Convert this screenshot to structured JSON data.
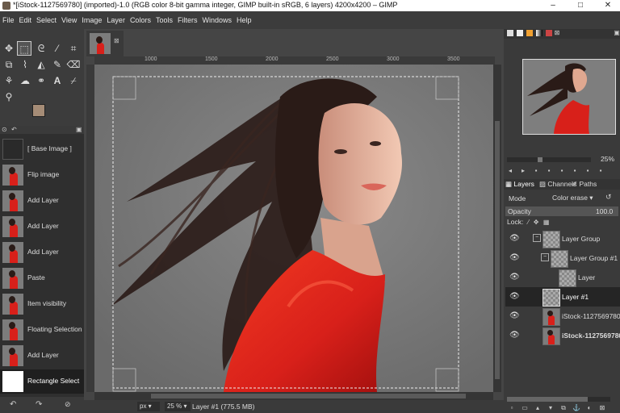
{
  "window": {
    "title": "*[iStock-1127569780] (imported)-1.0 (RGB color 8-bit gamma integer, GIMP built-in sRGB, 6 layers) 4200x4200 – GIMP",
    "controls": [
      "–",
      "□",
      "✕"
    ]
  },
  "menu": [
    "File",
    "Edit",
    "Select",
    "View",
    "Image",
    "Layer",
    "Colors",
    "Tools",
    "Filters",
    "Windows",
    "Help"
  ],
  "undo_history": [
    {
      "label": "[ Base Image ]"
    },
    {
      "label": "Flip image"
    },
    {
      "label": "Add Layer"
    },
    {
      "label": "Add Layer"
    },
    {
      "label": "Add Layer"
    },
    {
      "label": "Paste"
    },
    {
      "label": "Item visibility"
    },
    {
      "label": "Floating Selection t"
    },
    {
      "label": "Add Layer"
    },
    {
      "label": "Rectangle Select"
    }
  ],
  "ruler": {
    "labels": [
      "1000",
      "1500",
      "2000",
      "2500",
      "3000",
      "3500"
    ]
  },
  "status": {
    "unit": "px",
    "zoom": "25 %",
    "layer_info": "Layer #1 (775.5 MB)"
  },
  "navigation": {
    "zoom": "25%"
  },
  "dock_tabs": {
    "layers": "Layers",
    "channels": "Channels",
    "paths": "Paths"
  },
  "layers_panel": {
    "mode_label": "Mode",
    "mode_value": "Color erase",
    "opacity_label": "Opacity",
    "opacity_value": "100.0",
    "lock_label": "Lock:",
    "layers": [
      {
        "name": "Layer Group"
      },
      {
        "name": "Layer Group #1"
      },
      {
        "name": "Layer"
      },
      {
        "name": "Layer #1"
      },
      {
        "name": "iStock-1127569780"
      },
      {
        "name": "iStock-1127569780"
      }
    ]
  },
  "colors": {
    "fg": "#a58c76",
    "bg": "#ffffff",
    "accent_red": "#d8201a",
    "hair": "#2a1b17",
    "skin": "#e6b49e"
  }
}
